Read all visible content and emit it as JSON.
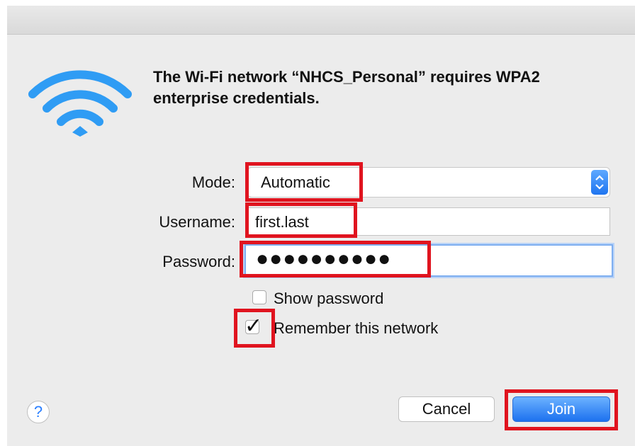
{
  "dialog": {
    "message": "The Wi-Fi network “NHCS_Personal” requires WPA2 enterprise credentials."
  },
  "form": {
    "mode_label": "Mode:",
    "mode_value": "Automatic",
    "username_label": "Username:",
    "username_value": "first.last",
    "password_label": "Password:",
    "password_mask": "●●●●●●●●●●",
    "show_password_label": "Show password",
    "show_password_checked": false,
    "remember_label": "Remember this network",
    "remember_checked": true,
    "remember_checkmark": "✓"
  },
  "buttons": {
    "help": "?",
    "cancel": "Cancel",
    "join": "Join"
  },
  "icons": {
    "wifi": "wifi-icon",
    "popup_arrows": "chevron-updown-icon",
    "check": "checkmark-icon"
  },
  "colors": {
    "accent": "#1f75f0",
    "highlight": "#e0141f",
    "wifi": "#2f9cf4"
  }
}
